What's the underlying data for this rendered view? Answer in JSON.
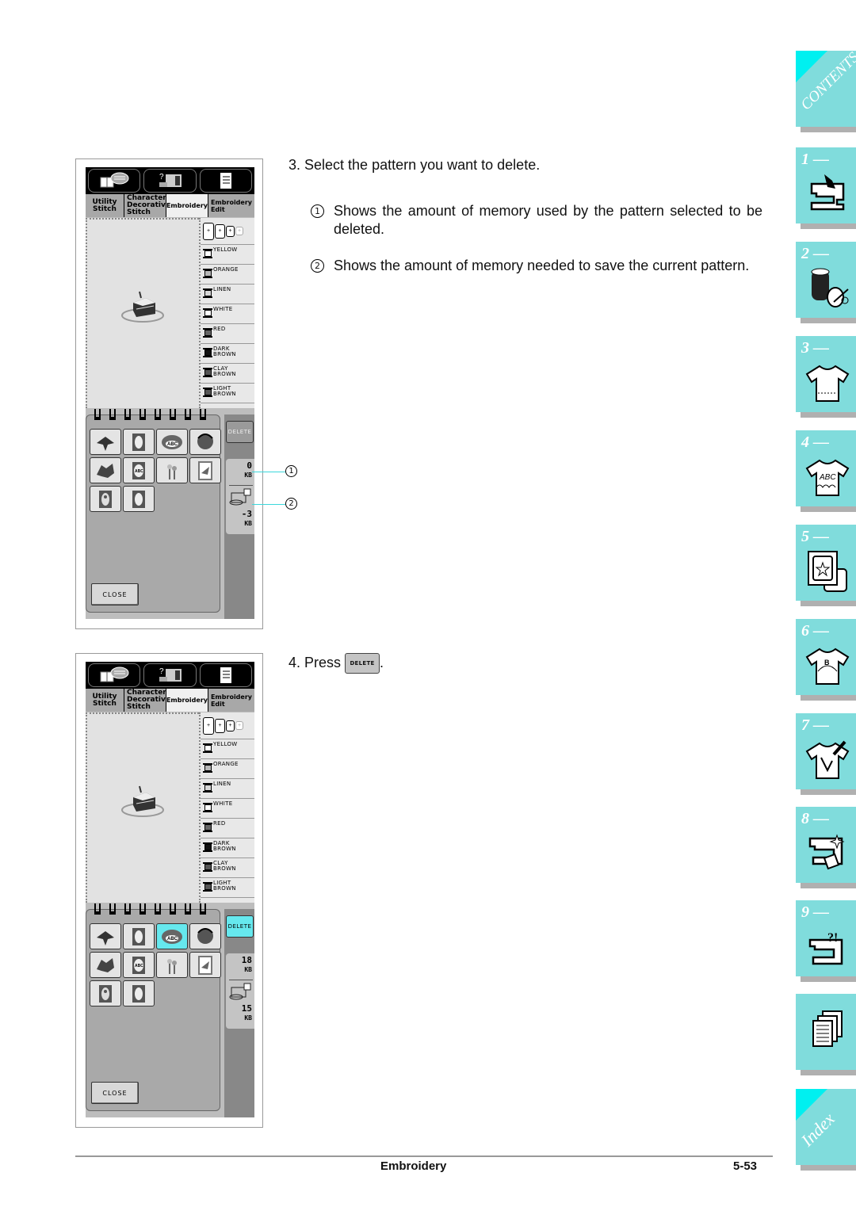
{
  "screens": [
    {
      "top_buttons": [
        "book-icon",
        "sewing-help-icon",
        "list-icon"
      ],
      "tabs": [
        "Utility\nStitch",
        "Character\nDecorative\nStitch",
        "Embroidery",
        "Embroidery\nEdit"
      ],
      "hoops": [
        "+",
        "+",
        "+",
        "+"
      ],
      "colors": [
        "YELLOW",
        "ORANGE",
        "LINEN",
        "WHITE",
        "RED",
        "DARK\nBROWN",
        "CLAY\nBROWN",
        "LIGHT\nBROWN"
      ],
      "color_swatches": [
        "#ffffff",
        "#b8b8b8",
        "#d8d8d8",
        "#ffffff",
        "#666666",
        "#111111",
        "#555555",
        "#555555"
      ],
      "patterns": [
        "bird",
        "framed-cat",
        "abc-wreath",
        "flower-basket",
        "dragon",
        "framed-abc",
        "flowers",
        "framed-bird",
        "framed-lady",
        "framed-cat"
      ],
      "selected_pattern": -1,
      "delete_label": "DELETE",
      "delete_active": false,
      "memory_used": "0",
      "memory_used_unit": "KB",
      "memory_needed": "-3",
      "memory_needed_unit": "KB",
      "close_label": "CLOSE"
    },
    {
      "top_buttons": [
        "book-icon",
        "sewing-help-icon",
        "list-icon"
      ],
      "tabs": [
        "Utility\nStitch",
        "Character\nDecorative\nStitch",
        "Embroidery",
        "Embroidery\nEdit"
      ],
      "hoops": [
        "+",
        "+",
        "+",
        "+"
      ],
      "colors": [
        "YELLOW",
        "ORANGE",
        "LINEN",
        "WHITE",
        "RED",
        "DARK\nBROWN",
        "CLAY\nBROWN",
        "LIGHT\nBROWN"
      ],
      "color_swatches": [
        "#ffffff",
        "#b8b8b8",
        "#d8d8d8",
        "#ffffff",
        "#666666",
        "#111111",
        "#555555",
        "#555555"
      ],
      "patterns": [
        "bird",
        "framed-cat",
        "abc-wreath",
        "flower-basket",
        "dragon",
        "framed-abc",
        "flowers",
        "framed-bird",
        "framed-lady",
        "framed-cat"
      ],
      "selected_pattern": 2,
      "delete_label": "DELETE",
      "delete_active": true,
      "memory_used": "18",
      "memory_used_unit": "KB",
      "memory_needed": "15",
      "memory_needed_unit": "KB",
      "close_label": "CLOSE"
    }
  ],
  "callouts": [
    "①",
    "②"
  ],
  "instructions": {
    "step3": "3.  Select the pattern you want to delete.",
    "note1_num": "1",
    "note1": "Shows the amount of memory used by the pattern selected to be deleted.",
    "note2_num": "2",
    "note2": "Shows the amount of memory needed to save the current pattern.",
    "step4_prefix": "4.  Press",
    "step4_button": "DELETE",
    "step4_suffix": "."
  },
  "footer": {
    "section": "Embroidery",
    "page": "5-53"
  },
  "side_tabs": [
    {
      "label": "CONTENTS",
      "icon": "contents-corner"
    },
    {
      "label": "1 —",
      "icon": "sewing-machine-hand-icon"
    },
    {
      "label": "2 —",
      "icon": "thread-spool-scissors-icon"
    },
    {
      "label": "3 —",
      "icon": "shirt-stitch-icon"
    },
    {
      "label": "4 —",
      "icon": "shirt-abc-icon",
      "icon_text": "ABC"
    },
    {
      "label": "5 —",
      "icon": "embroidery-frame-star-icon"
    },
    {
      "label": "6 —",
      "icon": "shirt-edit-icon",
      "icon_text": "B"
    },
    {
      "label": "7 —",
      "icon": "shirt-pen-icon"
    },
    {
      "label": "8 —",
      "icon": "machine-maintenance-icon"
    },
    {
      "label": "9 —",
      "icon": "machine-troubleshoot-icon",
      "icon_text": "?!"
    },
    {
      "label": "",
      "icon": "documents-icon"
    },
    {
      "label": "Index",
      "icon": "index-corner"
    }
  ],
  "colors": {
    "tab_teal": "#80dcdc",
    "tab_corner": "#00f0f0",
    "selected_cyan": "#66e8ee",
    "leader_line": "#3cd8dc"
  }
}
